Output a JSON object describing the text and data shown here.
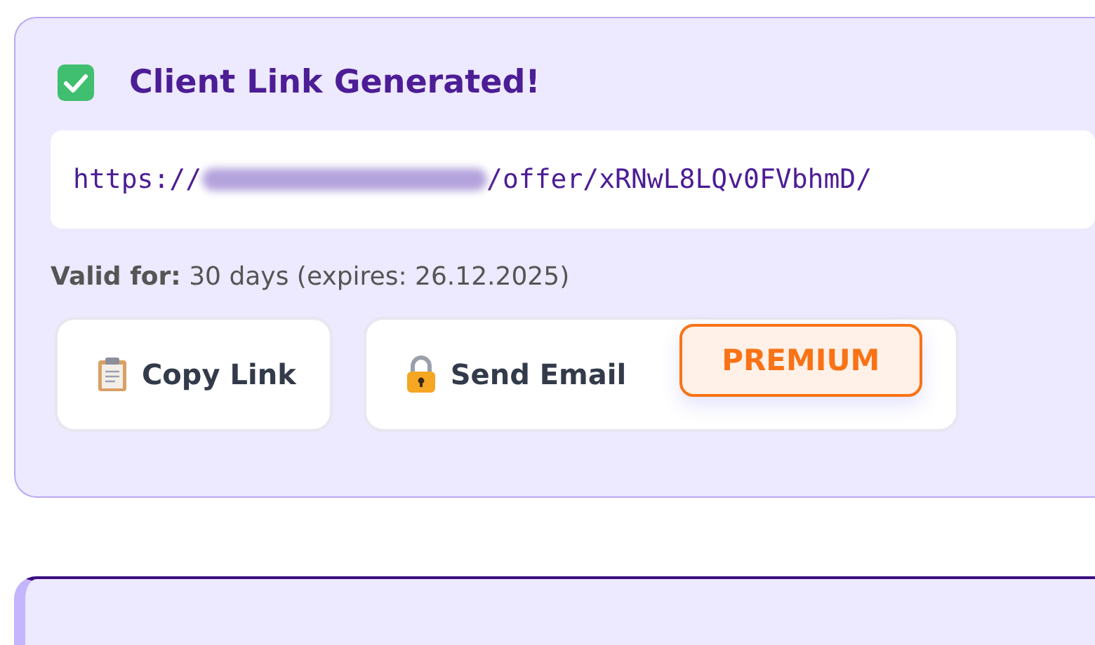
{
  "result_card": {
    "title": "Client Link Generated!",
    "link": {
      "prefix": "https://",
      "redacted": true,
      "suffix": "/offer/xRNwL8LQv0FVbhmD/"
    },
    "validity": {
      "label": "Valid for:",
      "value": "30 days (expires: 26.12.2025)"
    },
    "buttons": [
      {
        "kind": "copy",
        "label": "Copy Link"
      },
      {
        "kind": "email",
        "label": "Send Email",
        "badge": "PREMIUM"
      }
    ]
  },
  "next_card": {
    "kind": "card"
  }
}
